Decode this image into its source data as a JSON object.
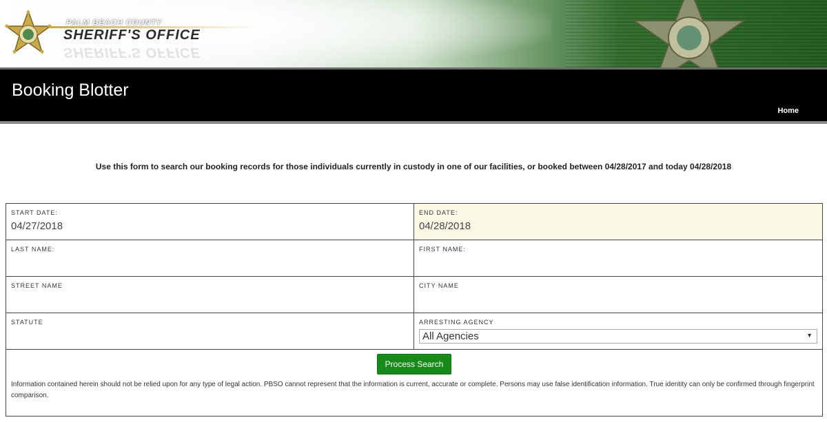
{
  "header": {
    "county": "PALM BEACH COUNTY",
    "office": "SHERIFF'S OFFICE"
  },
  "titlebar": {
    "title": "Booking Blotter",
    "home_link": "Home"
  },
  "intro": "Use this form to search our booking records for those individuals currently in custody in one of our facilities, or booked between 04/28/2017 and today 04/28/2018",
  "form": {
    "start_date": {
      "label": "START DATE:",
      "value": "04/27/2018"
    },
    "end_date": {
      "label": "END DATE:",
      "value": "04/28/2018"
    },
    "last_name": {
      "label": "LAST NAME:",
      "value": ""
    },
    "first_name": {
      "label": "FIRST NAME:",
      "value": ""
    },
    "street_name": {
      "label": "STREET NAME",
      "value": ""
    },
    "city_name": {
      "label": "CITY NAME",
      "value": ""
    },
    "statute": {
      "label": "STATUTE",
      "value": ""
    },
    "arresting_agency": {
      "label": "ARRESTING AGENCY",
      "selected": "All Agencies"
    },
    "submit_label": "Process Search",
    "disclaimer": "Information contained herein should not be relied upon for any type of legal action. PBSO cannot represent that the information is current, accurate or complete. Persons may use false identification information. True identity can only be confirmed through fingerprint comparison."
  },
  "colors": {
    "button": "#188a1a",
    "titlebar": "#000000",
    "highlight_field": "#fbf9e6"
  },
  "icons": {
    "logo": "star-badge-icon",
    "dropdown": "caret-down-icon"
  }
}
